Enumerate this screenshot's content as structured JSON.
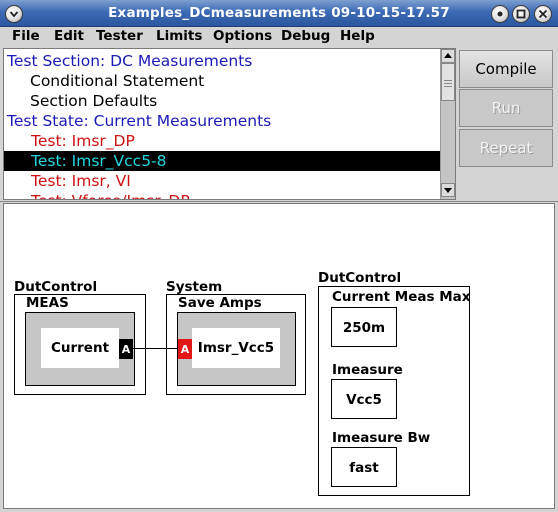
{
  "window": {
    "title": "Examples_DCmeasurements 09-10-15-17.57"
  },
  "menu": [
    {
      "label": "File"
    },
    {
      "label": "Edit"
    },
    {
      "label": "Tester"
    },
    {
      "label": "Limits"
    },
    {
      "label": "Options"
    },
    {
      "label": "Debug"
    },
    {
      "label": "Help"
    }
  ],
  "test_list": {
    "items": [
      {
        "label": "Test Section: DC Measurements",
        "style": "section"
      },
      {
        "label": "Conditional Statement",
        "style": "plain"
      },
      {
        "label": "Section Defaults",
        "style": "plain"
      },
      {
        "label": "Test State: Current Measurements",
        "style": "section"
      },
      {
        "label": "Test: Imsr_DP",
        "style": "red"
      },
      {
        "label": "Test: Imsr_Vcc5-8",
        "style": "selected"
      },
      {
        "label": "Test: Imsr, VI",
        "style": "red"
      },
      {
        "label": "Test: Vforce/Imsr_DP",
        "style": "red"
      }
    ]
  },
  "actions": {
    "compile": "Compile",
    "run": "Run",
    "repeat": "Repeat"
  },
  "canvas": {
    "block1": {
      "group": "DutControl",
      "name": "MEAS",
      "value": "Current",
      "port": "A"
    },
    "block2": {
      "group": "System",
      "name": "Save  Amps",
      "value": "Imsr_Vcc5",
      "port": "A"
    },
    "block3": {
      "group": "DutControl",
      "fields": [
        {
          "label": "Current Meas Max",
          "value": "250m"
        },
        {
          "label": "Imeasure",
          "value": "Vcc5"
        },
        {
          "label": "Imeasure Bw",
          "value": "fast"
        }
      ]
    }
  },
  "colors": {
    "titlebar": "#3c6ab5",
    "section_text": "#1a1ab8",
    "test_text": "#cc1111",
    "selected_bg": "#000000",
    "selected_text": "#22d8e0",
    "input_port": "#e21818"
  }
}
